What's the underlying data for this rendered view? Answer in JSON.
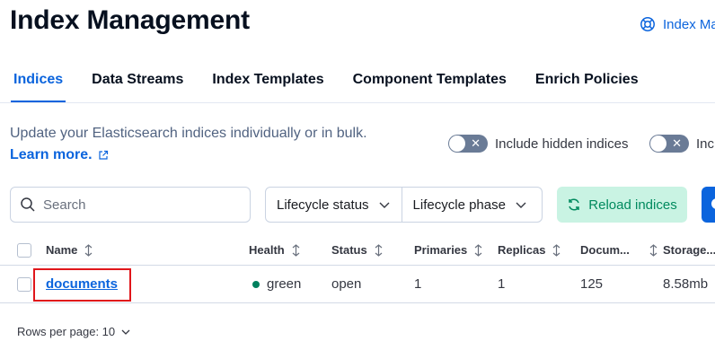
{
  "header": {
    "title": "Index Management",
    "docs_link": "Index Ma"
  },
  "tabs": [
    {
      "label": "Indices",
      "active": true
    },
    {
      "label": "Data Streams"
    },
    {
      "label": "Index Templates"
    },
    {
      "label": "Component Templates"
    },
    {
      "label": "Enrich Policies"
    }
  ],
  "intro": {
    "description": "Update your Elasticsearch indices individually or in bulk.",
    "learn_more": "Learn more."
  },
  "toggles": {
    "hidden": "Include hidden indices",
    "second": "Incl"
  },
  "search": {
    "placeholder": "Search"
  },
  "filters": {
    "lifecycle_status": "Lifecycle status",
    "lifecycle_phase": "Lifecycle phase"
  },
  "buttons": {
    "reload": "Reload indices"
  },
  "table": {
    "headers": {
      "name": "Name",
      "health": "Health",
      "status": "Status",
      "primaries": "Primaries",
      "replicas": "Replicas",
      "docs": "Docum...",
      "storage": "Storage..."
    },
    "rows": [
      {
        "name": "documents",
        "health": "green",
        "status": "open",
        "primaries": "1",
        "replicas": "1",
        "docs": "125",
        "storage": "8.58mb"
      }
    ]
  },
  "pager": {
    "rows_per_page": "Rows per page: 10"
  },
  "colors": {
    "accent": "#0b64dd",
    "success": "#00805e",
    "reload_bg": "#c9f3e3",
    "highlight": "#e0161b"
  }
}
